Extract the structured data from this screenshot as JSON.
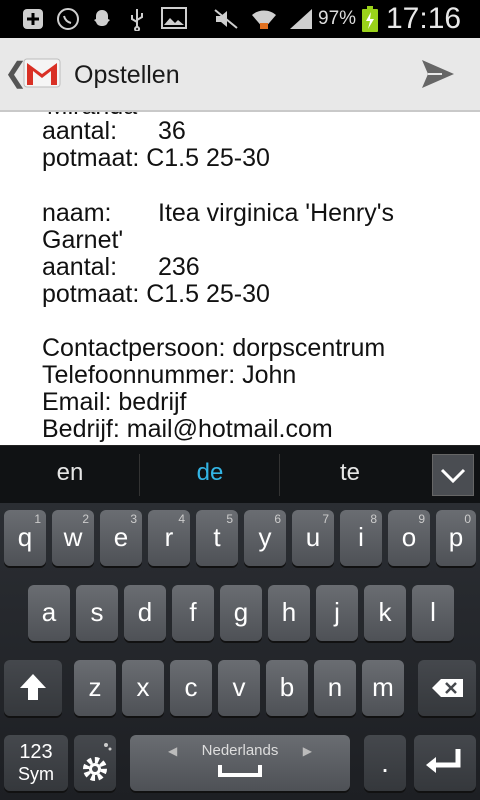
{
  "status_bar": {
    "battery_percent": "97%",
    "clock": "17:16",
    "battery_level": 0.97,
    "icons": [
      "plus-icon",
      "whatsapp-icon",
      "snapchat-icon",
      "usb-icon",
      "image-icon",
      "mute-icon",
      "wifi-icon",
      "signal-icon",
      "battery-icon"
    ]
  },
  "action_bar": {
    "title": "Opstellen",
    "app_icon": "gmail-icon",
    "back_icon": "chevron-left-icon",
    "send_icon": "send-icon"
  },
  "message": {
    "lines": [
      {
        "label": "'Miranda'",
        "value": ""
      },
      {
        "label": "aantal:",
        "value": "36"
      },
      {
        "label": "potmaat: C1.5 25-30",
        "value": ""
      },
      {
        "label": "naam:",
        "value": "Itea virginica 'Henry's"
      },
      {
        "label": "Garnet'",
        "value": ""
      },
      {
        "label": "aantal:",
        "value": "236"
      },
      {
        "label": "potmaat: C1.5 25-30",
        "value": ""
      },
      {
        "label": "Contactpersoon: dorpscentrum",
        "value": ""
      },
      {
        "label": "Telefoonnummer: John",
        "value": ""
      },
      {
        "label": "Email: bedrijf",
        "value": ""
      },
      {
        "label": "Bedrijf: mail@hotmail.com",
        "value": ""
      }
    ]
  },
  "suggestions": {
    "items": [
      "en",
      "de",
      "te"
    ],
    "active_index": 1
  },
  "keyboard": {
    "row1": [
      {
        "ch": "q",
        "hint": "1"
      },
      {
        "ch": "w",
        "hint": "2"
      },
      {
        "ch": "e",
        "hint": "3"
      },
      {
        "ch": "r",
        "hint": "4"
      },
      {
        "ch": "t",
        "hint": "5"
      },
      {
        "ch": "y",
        "hint": "6"
      },
      {
        "ch": "u",
        "hint": "7"
      },
      {
        "ch": "i",
        "hint": "8"
      },
      {
        "ch": "o",
        "hint": "9"
      },
      {
        "ch": "p",
        "hint": "0"
      }
    ],
    "row2": [
      "a",
      "s",
      "d",
      "f",
      "g",
      "h",
      "j",
      "k",
      "l"
    ],
    "row3": [
      "z",
      "x",
      "c",
      "v",
      "b",
      "n",
      "m"
    ],
    "symbols_label_top": "123",
    "symbols_label_bottom": "Sym",
    "space_language": "Nederlands",
    "period_label": ".",
    "settings_icon": "gear-icon",
    "shift_icon": "shift-icon",
    "backspace_icon": "backspace-icon",
    "enter_icon": "enter-icon"
  }
}
